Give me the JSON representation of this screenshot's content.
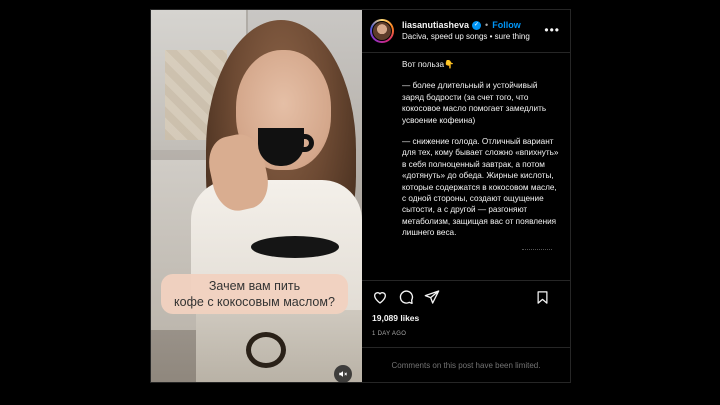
{
  "post": {
    "media": {
      "caption_overlay": "Зачем вам пить\nкофе с кокосовым маслом?",
      "mute_icon": "speaker-muted-icon"
    },
    "header": {
      "username": "liasanutiasheva",
      "verified_icon": "verified-badge-icon",
      "separator": "•",
      "follow_label": "Follow",
      "audio": "Daciva, speed up songs • sure thing",
      "more_icon": "more-options-icon"
    },
    "caption": {
      "paragraphs": [
        "Вот польза👇",
        "— более длительный и устойчивый заряд бодрости (за счет того, что кокосовое масло помогает замедлить усвоение кофеина)",
        "— снижение голода. Отличный вариант для тех, кому бывает сложно «впихнуть» в себя полноценный завтрак, а потом «дотянуть» до обеда. Жирные кислоты, которые содержатся в кокосовом масле, с одной стороны, создают ощущение сытости, а с другой — разгоняют метаболизм, защищая вас от появления лишнего веса."
      ]
    },
    "actions": {
      "like_icon": "heart-icon",
      "comment_icon": "comment-icon",
      "share_icon": "share-icon",
      "save_icon": "bookmark-icon"
    },
    "likes": "19,089 likes",
    "time": "1 DAY AGO",
    "comments_notice": "Comments on this post have been limited."
  },
  "colors": {
    "background": "#000000",
    "accent_blue": "#0095f6",
    "caption_box": "#f2d2c0",
    "muted_text": "#a8a8a8"
  }
}
